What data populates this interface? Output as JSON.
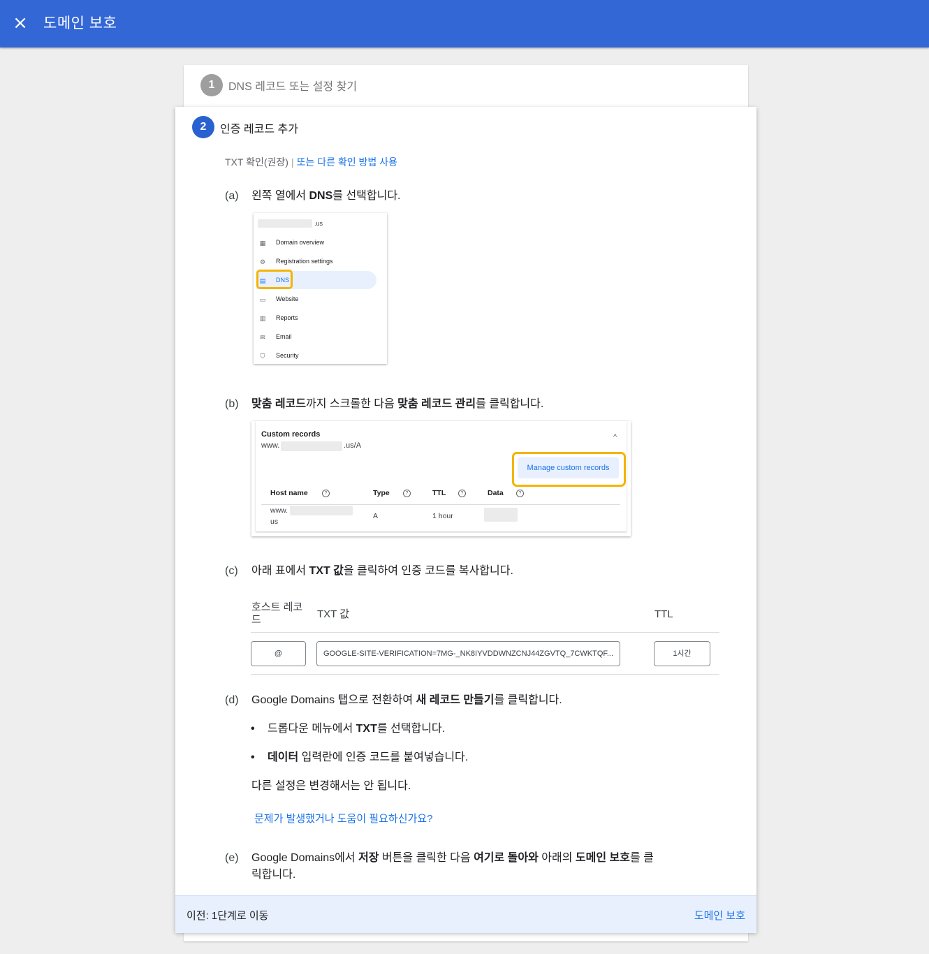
{
  "header": {
    "close_icon": "×",
    "title": "도메인 보호"
  },
  "step1": {
    "number": "1",
    "label": "DNS 레코드 또는 설정 찾기"
  },
  "step2": {
    "number": "2",
    "label": "인증 레코드 추가",
    "method_current": "TXT 확인(권장)",
    "method_sep": "|",
    "method_alt_link": "또는 다른 확인 방법 사용"
  },
  "item_a": {
    "mark": "(a)",
    "pre": "왼쪽 열에서 ",
    "bold": "DNS",
    "post": "를 선택합니다."
  },
  "screenshot_nav": {
    "domain_suffix": ".us",
    "items": [
      {
        "icon": "grid-icon",
        "glyph": "▦",
        "label": "Domain overview"
      },
      {
        "icon": "gear-icon",
        "glyph": "⚙",
        "label": "Registration settings"
      },
      {
        "icon": "dns-icon",
        "glyph": "▤",
        "label": "DNS"
      },
      {
        "icon": "website-icon",
        "glyph": "▭",
        "label": "Website"
      },
      {
        "icon": "reports-icon",
        "glyph": "▥",
        "label": "Reports"
      },
      {
        "icon": "email-icon",
        "glyph": "✉",
        "label": "Email"
      },
      {
        "icon": "shield-icon",
        "glyph": "⛉",
        "label": "Security"
      }
    ]
  },
  "item_b": {
    "mark": "(b)",
    "bold1": "맞춤 레코드",
    "mid": "까지 스크롤한 다음 ",
    "bold2": "맞춤 레코드 관리",
    "post": "를 클릭합니다."
  },
  "screenshot_custom": {
    "title": "Custom records",
    "host_prefix": "www.",
    "host_suffix": ".us/A",
    "caret": "^",
    "manage_button": "Manage custom records",
    "headers": [
      "Host name",
      "Type",
      "TTL",
      "Data"
    ],
    "help_glyph": "?",
    "row": {
      "host_prefix": "www.",
      "host_suffix": "us",
      "type": "A",
      "ttl": "1 hour"
    }
  },
  "item_c": {
    "mark": "(c)",
    "pre": "아래 표에서 ",
    "bold": "TXT 값",
    "post": "을 클릭하여 인증 코드를 복사합니다."
  },
  "txt_table": {
    "headers": {
      "host": "호스트 레코드",
      "value": "TXT 값",
      "ttl": "TTL"
    },
    "row": {
      "host": "@",
      "value": "GOOGLE-SITE-VERIFICATION=7MG-_NK8IYVDDWNZCNJ44ZGVTQ_7CWKTQF...",
      "ttl": "1시간"
    }
  },
  "item_d": {
    "mark": "(d)",
    "pre": "Google Domains 탭으로 전환하여 ",
    "bold": "새 레코드 만들기",
    "post": "를 클릭합니다."
  },
  "bullets": [
    {
      "dot": "•",
      "pre": "드롭다운 메뉴에서 ",
      "bold": "TXT",
      "post": "를 선택합니다."
    },
    {
      "dot": "•",
      "pre": "",
      "bold": "데이터",
      "post": " 입력란에 인증 코드를 붙여넣습니다."
    }
  ],
  "note": "다른 설정은 변경해서는 안 됩니다.",
  "help_link": "문제가 발생했거나 도움이 필요하신가요?",
  "item_e": {
    "mark": "(e)",
    "p1": "Google Domains에서 ",
    "b1": "저장",
    "p2": " 버튼을 클릭한 다음 ",
    "b2": "여기로 돌아와",
    "p3": " 아래의 ",
    "b3": "도메인 보호",
    "p4": "를 클",
    "p5": "릭합니다."
  },
  "footer": {
    "prev": "이전: 1단계로 이동",
    "next": "도메인 보호"
  }
}
